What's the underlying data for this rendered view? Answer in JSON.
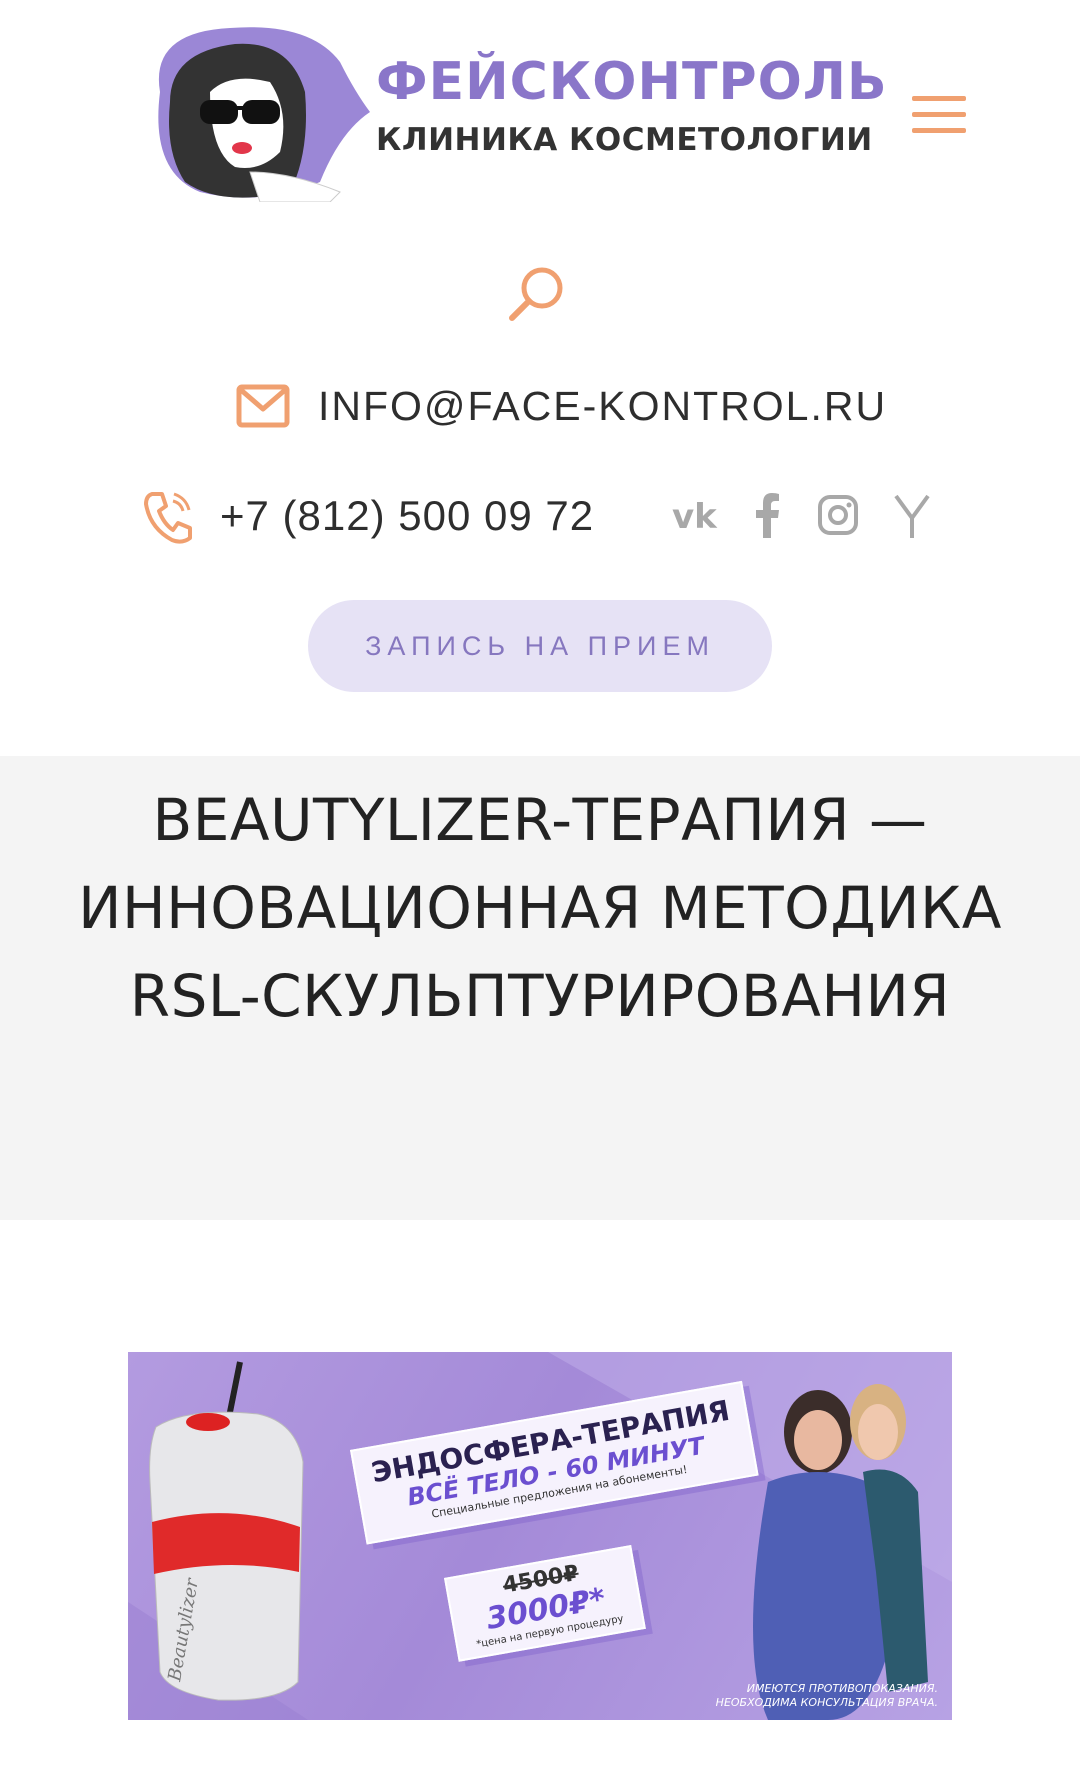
{
  "header": {
    "brand_name": "ФЕЙСКОНТРОЛЬ",
    "brand_tagline": "КЛИНИКА КОСМЕТОЛОГИИ",
    "menu_icon": "hamburger-icon",
    "search_icon": "search-icon"
  },
  "contacts": {
    "email": "INFO@FACE-KONTROL.RU",
    "phone": "+7 (812) 500 09 72",
    "socials": [
      "vk-icon",
      "facebook-icon",
      "instagram-icon",
      "yandex-icon"
    ]
  },
  "cta": {
    "label": "ЗАПИСЬ НА ПРИЕМ"
  },
  "page": {
    "title": "BEAUTYLIZER-ТЕРАПИЯ — ИННОВАЦИОННАЯ МЕТОДИКА RSL-СКУЛЬПТУРИРОВАНИЯ"
  },
  "banner": {
    "title": "ЭНДОСФЕРА-ТЕРАПИЯ",
    "subtitle": "ВСЁ ТЕЛО - 60 МИНУТ",
    "offer": "Специальные предложения на абонементы!",
    "old_price": "4500₽",
    "new_price": "3000₽*",
    "price_note": "*цена на первую процедуру",
    "disclaimer_line1": "ИМЕЮТСЯ ПРОТИВОПОКАЗАНИЯ.",
    "disclaimer_line2": "НЕОБХОДИМА КОНСУЛЬТАЦИЯ ВРАЧА.",
    "device_label": "Beautylizer"
  },
  "colors": {
    "accent_orange": "#f0a070",
    "brand_purple": "#8a76c9",
    "button_bg": "#e6e2f5",
    "title_band_bg": "#f4f4f4"
  }
}
